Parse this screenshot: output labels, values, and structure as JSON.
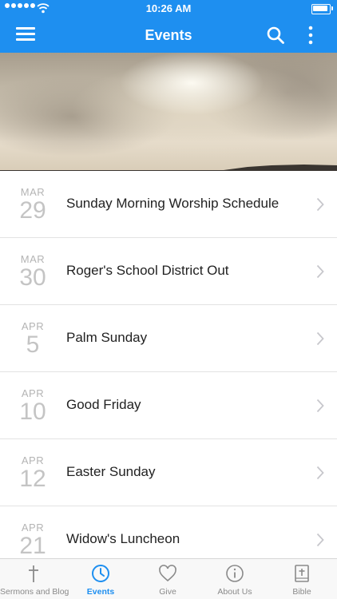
{
  "status_bar": {
    "time": "10:26 AM"
  },
  "header": {
    "title": "Events"
  },
  "colors": {
    "accent": "#1e8ff0",
    "inactive": "#8a8a8a"
  },
  "events": [
    {
      "month": "MAR",
      "day": "29",
      "title": "Sunday Morning Worship Schedule"
    },
    {
      "month": "MAR",
      "day": "30",
      "title": "Roger's School District Out"
    },
    {
      "month": "APR",
      "day": "5",
      "title": "Palm Sunday"
    },
    {
      "month": "APR",
      "day": "10",
      "title": "Good Friday"
    },
    {
      "month": "APR",
      "day": "12",
      "title": "Easter Sunday"
    },
    {
      "month": "APR",
      "day": "21",
      "title": "Widow's Luncheon"
    }
  ],
  "tabs": [
    {
      "label": "Sermons and Blog",
      "icon": "cross-icon"
    },
    {
      "label": "Events",
      "icon": "clock-icon",
      "active": true
    },
    {
      "label": "Give",
      "icon": "heart-icon"
    },
    {
      "label": "About Us",
      "icon": "info-icon"
    },
    {
      "label": "Bible",
      "icon": "bible-icon"
    }
  ]
}
